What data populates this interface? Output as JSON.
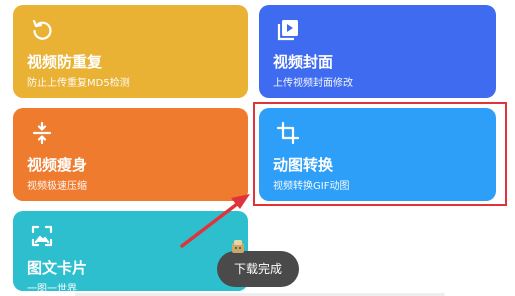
{
  "cards": [
    {
      "title": "视频防重复",
      "subtitle": "防止上传重复MD5检测",
      "icon": "rotate-icon",
      "color": "#E9B235"
    },
    {
      "title": "视频封面",
      "subtitle": "上传视频封面修改",
      "icon": "video-cover-icon",
      "color": "#3F6BF0"
    },
    {
      "title": "视频瘦身",
      "subtitle": "视频极速压缩",
      "icon": "compress-icon",
      "color": "#EE7B2E"
    },
    {
      "title": "动图转换",
      "subtitle": "视频转换GIF动图",
      "icon": "crop-icon",
      "color": "#2D9FF8"
    },
    {
      "title": "图文卡片",
      "subtitle": "一图一世界",
      "icon": "image-icon",
      "color": "#2DBFCE"
    }
  ],
  "toast": {
    "text": "下载完成"
  },
  "highlight_color": "#E0333A"
}
